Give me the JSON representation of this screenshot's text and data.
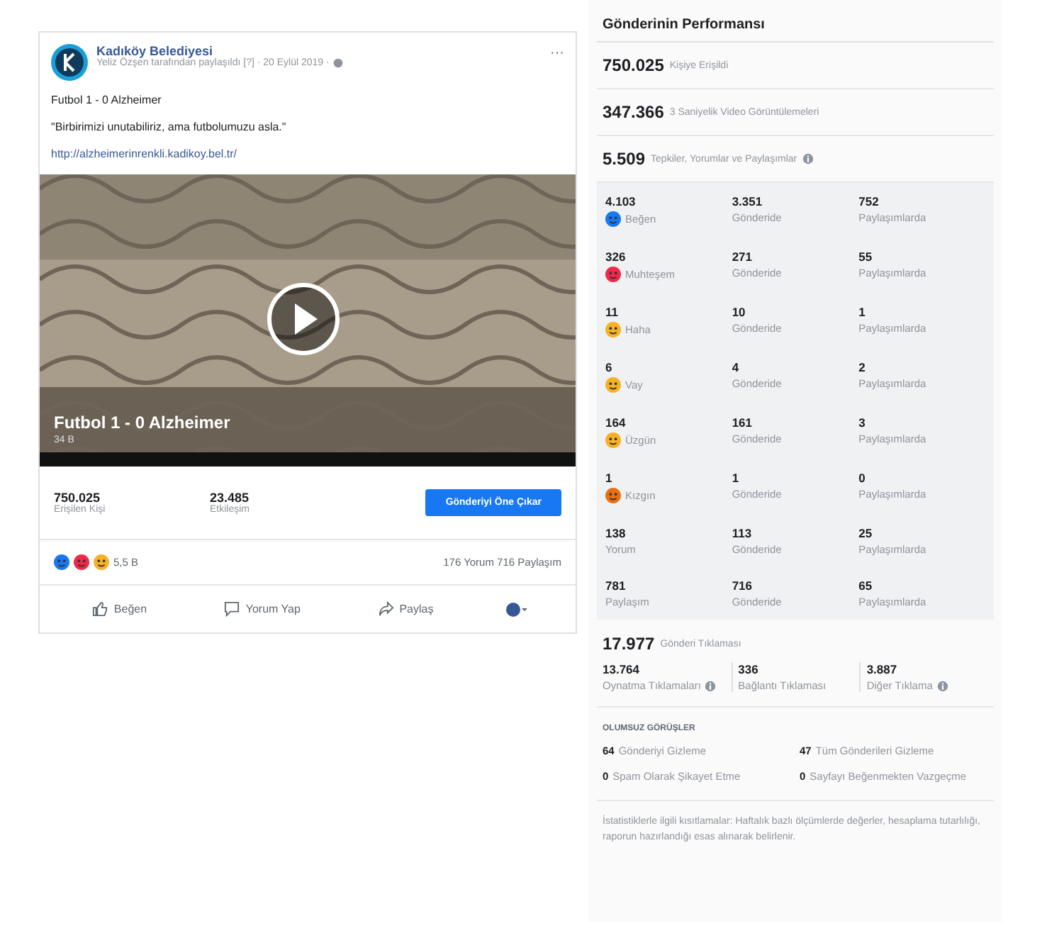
{
  "post": {
    "page_name": "Kadıköy Belediyesi",
    "meta": "Yeliz Özşen tarafından paylaşıldı [?] · 20 Eylül 2019 ·",
    "more": "···",
    "lines": [
      "Futbol 1 - 0 Alzheimer",
      "\"Birbirimizi unutabiliriz, ama futbolumuzu asla.\""
    ],
    "link": "http://alzheimerinrenkli.kadikoy.bel.tr/",
    "video": {
      "kind": "picture",
      "title": "Futbol 1 - 0 Alzheimer",
      "duration": "34 B"
    },
    "stats": [
      {
        "value": "750.025",
        "label": "Erişilen Kişi"
      },
      {
        "value": "23.485",
        "label": "Etkileşim"
      }
    ],
    "boost_button": "Gönderiyi Öne Çıkar",
    "reaction_count": "5,5 B",
    "comments_shares": "176 Yorum  716 Paylaşım",
    "actions": [
      {
        "kind": "like",
        "label": "Beğen"
      },
      {
        "kind": "comment",
        "label": "Yorum Yap"
      },
      {
        "kind": "share",
        "label": "Paylaş"
      }
    ]
  },
  "performance": {
    "title": "Gönderinin Performansı",
    "summary": [
      {
        "value": "750.025",
        "label": "Kişiye Erişildi",
        "info": false
      },
      {
        "value": "347.366",
        "label": "3 Saniyelik Video Görüntülemeleri",
        "info": false
      },
      {
        "value": "5.509",
        "label": "Tepkiler, Yorumlar ve Paylaşımlar",
        "info": true
      }
    ],
    "breakdown": [
      {
        "kind": "like",
        "total": "4.103",
        "label": "Beğen",
        "on_post": "3.351",
        "on_post_label": "Gönderide",
        "on_shares": "752",
        "on_shares_label": "Paylaşımlarda"
      },
      {
        "kind": "love",
        "total": "326",
        "label": "Muhteşem",
        "on_post": "271",
        "on_post_label": "Gönderide",
        "on_shares": "55",
        "on_shares_label": "Paylaşımlarda"
      },
      {
        "kind": "haha",
        "total": "11",
        "label": "Haha",
        "on_post": "10",
        "on_post_label": "Gönderide",
        "on_shares": "1",
        "on_shares_label": "Paylaşımlarda"
      },
      {
        "kind": "wow",
        "total": "6",
        "label": "Vay",
        "on_post": "4",
        "on_post_label": "Gönderide",
        "on_shares": "2",
        "on_shares_label": "Paylaşımlarda"
      },
      {
        "kind": "sad",
        "total": "164",
        "label": "Üzgün",
        "on_post": "161",
        "on_post_label": "Gönderide",
        "on_shares": "3",
        "on_shares_label": "Paylaşımlarda"
      },
      {
        "kind": "angry",
        "total": "1",
        "label": "Kızgın",
        "on_post": "1",
        "on_post_label": "Gönderide",
        "on_shares": "0",
        "on_shares_label": "Paylaşımlarda"
      },
      {
        "kind": "plain",
        "total": "138",
        "label": "Yorum",
        "on_post": "113",
        "on_post_label": "Gönderide",
        "on_shares": "25",
        "on_shares_label": "Paylaşımlarda"
      },
      {
        "kind": "plain",
        "total": "781",
        "label": "Paylaşım",
        "on_post": "716",
        "on_post_label": "Gönderide",
        "on_shares": "65",
        "on_shares_label": "Paylaşımlarda"
      }
    ],
    "clicks": {
      "value": "17.977",
      "label": "Gönderi Tıklaması",
      "items": [
        {
          "value": "13.764",
          "label": "Oynatma Tıklamaları",
          "info": true
        },
        {
          "value": "336",
          "label": "Bağlantı Tıklaması",
          "info": false
        },
        {
          "value": "3.887",
          "label": "Diğer Tıklama",
          "info": true
        }
      ]
    },
    "negative": {
      "title": "OLUMSUZ GÖRÜŞLER",
      "items": [
        {
          "value": "64",
          "label": "Gönderiyi Gizleme"
        },
        {
          "value": "47",
          "label": "Tüm Gönderileri Gizleme"
        },
        {
          "value": "0",
          "label": "Spam Olarak Şikayet Etme"
        },
        {
          "value": "0",
          "label": "Sayfayı Beğenmekten Vazgeçme"
        }
      ]
    },
    "footnote": "İstatistiklerle ilgili kısıtlamalar: Haftalık bazlı ölçümlerde değerler, hesaplama tutarlılığı, raporun hazırlandığı esas alınarak belirlenir."
  }
}
